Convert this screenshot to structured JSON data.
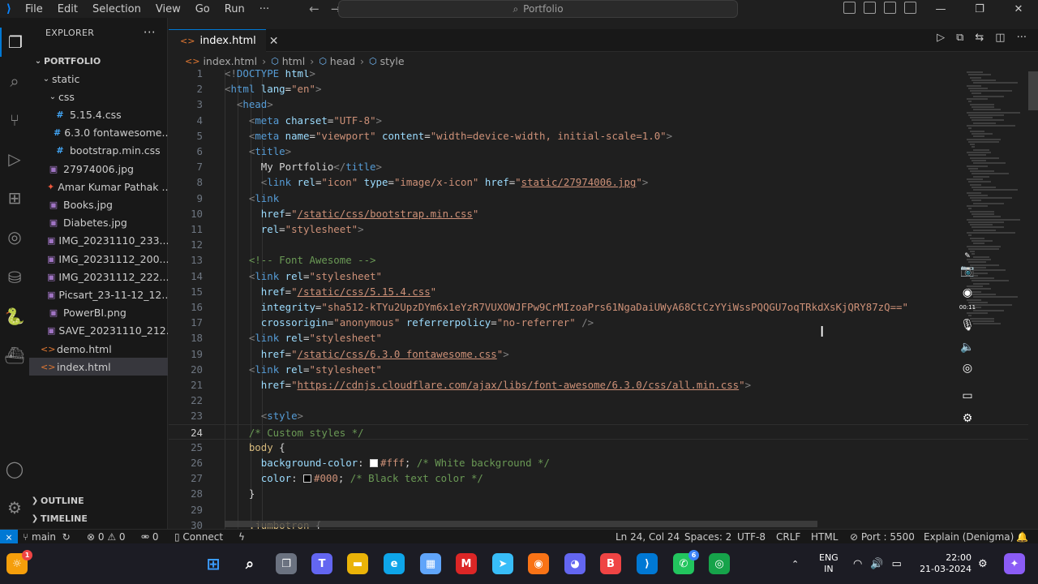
{
  "titlebar": {
    "menu": [
      "File",
      "Edit",
      "Selection",
      "View",
      "Go",
      "Run",
      "···"
    ],
    "search_text": "Portfolio"
  },
  "sidebar": {
    "title": "EXPLORER",
    "more": "···",
    "root": "PORTFOLIO",
    "items": [
      {
        "label": "static",
        "kind": "folder",
        "depth": 1
      },
      {
        "label": "css",
        "kind": "folder",
        "depth": 2
      },
      {
        "label": "5.15.4.css",
        "kind": "css",
        "depth": 3
      },
      {
        "label": "6.3.0 fontawesome....",
        "kind": "css",
        "depth": 3
      },
      {
        "label": "bootstrap.min.css",
        "kind": "css",
        "depth": 3
      },
      {
        "label": "27974006.jpg",
        "kind": "img",
        "depth": 2
      },
      {
        "label": "Amar Kumar Pathak ...",
        "kind": "pdf",
        "depth": 2
      },
      {
        "label": "Books.jpg",
        "kind": "img",
        "depth": 2
      },
      {
        "label": "Diabetes.jpg",
        "kind": "img",
        "depth": 2
      },
      {
        "label": "IMG_20231110_233...",
        "kind": "img",
        "depth": 2
      },
      {
        "label": "IMG_20231112_200...",
        "kind": "img",
        "depth": 2
      },
      {
        "label": "IMG_20231112_222...",
        "kind": "img",
        "depth": 2
      },
      {
        "label": "Picsart_23-11-12_12...",
        "kind": "img",
        "depth": 2
      },
      {
        "label": "PowerBI.png",
        "kind": "img",
        "depth": 2
      },
      {
        "label": "SAVE_20231110_212...",
        "kind": "img",
        "depth": 2
      },
      {
        "label": "demo.html",
        "kind": "html",
        "depth": 1
      },
      {
        "label": "index.html",
        "kind": "html",
        "depth": 1,
        "selected": true
      }
    ],
    "outline": "OUTLINE",
    "timeline": "TIMELINE"
  },
  "tab": {
    "label": "index.html",
    "close": "✕"
  },
  "breadcrumb": [
    "index.html",
    "html",
    "head",
    "style"
  ],
  "editor": {
    "current_line": 24,
    "lines": [
      {
        "n": "1",
        "html": "<span class='t-brk'>&lt;!</span><span class='t-tag'>DOCTYPE</span> <span class='t-attr'>html</span><span class='t-brk'>&gt;</span>"
      },
      {
        "n": "2",
        "html": "<span class='t-brk'>&lt;</span><span class='t-tag'>html</span> <span class='t-attr'>lang</span>=<span class='t-str'>\"en\"</span><span class='t-brk'>&gt;</span>"
      },
      {
        "n": "3",
        "html": "  <span class='t-brk'>&lt;</span><span class='t-tag'>head</span><span class='t-brk'>&gt;</span>"
      },
      {
        "n": "4",
        "html": "    <span class='t-brk'>&lt;</span><span class='t-tag'>meta</span> <span class='t-attr'>charset</span>=<span class='t-str'>\"UTF-8\"</span><span class='t-brk'>&gt;</span>"
      },
      {
        "n": "5",
        "html": "    <span class='t-brk'>&lt;</span><span class='t-tag'>meta</span> <span class='t-attr'>name</span>=<span class='t-str'>\"viewport\"</span> <span class='t-attr'>content</span>=<span class='t-str'>\"width=device-width, initial-scale=1.0\"</span><span class='t-brk'>&gt;</span>"
      },
      {
        "n": "6",
        "html": "    <span class='t-brk'>&lt;</span><span class='t-tag'>title</span><span class='t-brk'>&gt;</span>"
      },
      {
        "n": "7",
        "html": "      <span class='t-txt'>My Portfolio</span><span class='t-brk'>&lt;/</span><span class='t-tag'>title</span><span class='t-brk'>&gt;</span>"
      },
      {
        "n": "8",
        "html": "      <span class='t-brk'>&lt;</span><span class='t-tag'>link</span> <span class='t-attr'>rel</span>=<span class='t-str'>\"icon\"</span> <span class='t-attr'>type</span>=<span class='t-str'>\"image/x-icon\"</span> <span class='t-attr'>href</span>=<span class='t-str'>\"<span class='t-link'>static/27974006.jpg</span>\"</span><span class='t-brk'>&gt;</span>"
      },
      {
        "n": "9",
        "html": "    <span class='t-brk'>&lt;</span><span class='t-tag'>link</span>"
      },
      {
        "n": "10",
        "html": "      <span class='t-attr'>href</span>=<span class='t-str'>\"<span class='t-link'>/static/css/bootstrap.min.css</span>\"</span>"
      },
      {
        "n": "11",
        "html": "      <span class='t-attr'>rel</span>=<span class='t-str'>\"stylesheet\"</span><span class='t-brk'>&gt;</span>"
      },
      {
        "n": "12",
        "html": ""
      },
      {
        "n": "13",
        "html": "    <span class='t-com'>&lt;!-- Font Awesome --&gt;</span>"
      },
      {
        "n": "14",
        "html": "    <span class='t-brk'>&lt;</span><span class='t-tag'>link</span> <span class='t-attr'>rel</span>=<span class='t-str'>\"stylesheet\"</span>"
      },
      {
        "n": "15",
        "html": "      <span class='t-attr'>href</span>=<span class='t-str'>\"<span class='t-link'>/static/css/5.15.4.css</span>\"</span>"
      },
      {
        "n": "16",
        "html": "      <span class='t-attr'>integrity</span>=<span class='t-str'>\"sha512-kTYu2UpzDYm6x1eYzR7VUXOWJFPw9CrMIzoaPrs61NgaDaiUWyA68CtCzYYiWssPQQGU7oqTRkdXsKjQRY87zQ==\"</span>"
      },
      {
        "n": "17",
        "html": "      <span class='t-attr'>crossorigin</span>=<span class='t-str'>\"anonymous\"</span> <span class='t-attr'>referrerpolicy</span>=<span class='t-str'>\"no-referrer\"</span> <span class='t-brk'>/&gt;</span>"
      },
      {
        "n": "18",
        "html": "    <span class='t-brk'>&lt;</span><span class='t-tag'>link</span> <span class='t-attr'>rel</span>=<span class='t-str'>\"stylesheet\"</span>"
      },
      {
        "n": "19",
        "html": "      <span class='t-attr'>href</span>=<span class='t-str'>\"<span class='t-link'>/static/css/6.3.0 fontawesome.css</span>\"</span><span class='t-brk'>&gt;</span>"
      },
      {
        "n": "20",
        "html": "    <span class='t-brk'>&lt;</span><span class='t-tag'>link</span> <span class='t-attr'>rel</span>=<span class='t-str'>\"stylesheet\"</span>"
      },
      {
        "n": "21",
        "html": "      <span class='t-attr'>href</span>=<span class='t-str'>\"<span class='t-link'>https://cdnjs.cloudflare.com/ajax/libs/font-awesome/6.3.0/css/all.min.css</span>\"</span><span class='t-brk'>&gt;</span>"
      },
      {
        "n": "22",
        "html": ""
      },
      {
        "n": "23",
        "html": "      <span class='t-brk'>&lt;</span><span class='t-tag'>style</span><span class='t-brk'>&gt;</span>"
      },
      {
        "n": "24",
        "html": "    <span class='t-com'>/* Custom styles */</span>"
      },
      {
        "n": "25",
        "html": "    <span class='t-sel'>body</span> {"
      },
      {
        "n": "26",
        "html": "      <span class='t-prop'>background-color</span>: <span class='swatch' style='background:#fff'></span><span class='t-val'>#fff</span>; <span class='t-com'>/* White background */</span>"
      },
      {
        "n": "27",
        "html": "      <span class='t-prop'>color</span>: <span class='swatch' style='background:#000'></span><span class='t-val'>#000</span>; <span class='t-com'>/* Black text color */</span>"
      },
      {
        "n": "28",
        "html": "    }"
      },
      {
        "n": "29",
        "html": ""
      },
      {
        "n": "30",
        "html": "    <span class='t-sel'>.jumbotron</span> {"
      }
    ]
  },
  "statusbar": {
    "remote": "⨯",
    "branch": "main",
    "errors": "0",
    "warnings": "0",
    "ports": "0",
    "connect": "Connect",
    "position": "Ln 24, Col 24",
    "spaces": "Spaces: 2",
    "encoding": "UTF-8",
    "eol": "CRLF",
    "language": "HTML",
    "port": "Port : 5500",
    "explain": "Explain (Denigma)"
  },
  "recorder": {
    "timer": "00:11"
  },
  "taskbar": {
    "lang_top": "ENG",
    "lang_bottom": "IN",
    "time": "22:00",
    "date": "21-03-2024",
    "badges": {
      "whatsapp": "6"
    }
  },
  "colors": {
    "accent": "#0078d4",
    "bg": "#1f1f1f",
    "sidebar": "#181818"
  }
}
